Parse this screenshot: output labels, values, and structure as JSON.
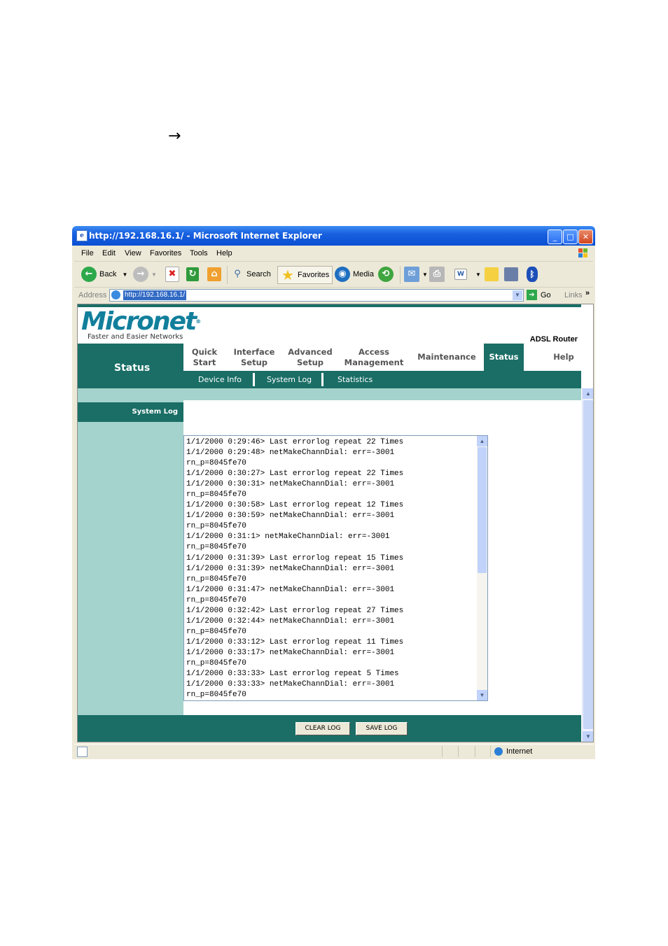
{
  "doc": {
    "arrow": "→"
  },
  "window": {
    "title": "http://192.168.16.1/ - Microsoft Internet Explorer",
    "minimize": "_",
    "maximize": "□",
    "close": "✕"
  },
  "menu": [
    "File",
    "Edit",
    "View",
    "Favorites",
    "Tools",
    "Help"
  ],
  "toolbar": {
    "back": "Back",
    "search": "Search",
    "favorites": "Favorites",
    "media": "Media"
  },
  "address": {
    "label": "Address",
    "value": "http://192.168.16.1/",
    "go": "Go",
    "links": "Links",
    "more": "»"
  },
  "router": {
    "logo": "Micronet",
    "logo_mark": "®",
    "tagline": "Faster and Easier Networks",
    "product": "ADSL Router",
    "section": "Status",
    "tabs": [
      {
        "l1": "Quick",
        "l2": "Start"
      },
      {
        "l1": "Interface",
        "l2": "Setup"
      },
      {
        "l1": "Advanced",
        "l2": "Setup"
      },
      {
        "l1": "Access",
        "l2": "Management"
      },
      {
        "l1": "Maintenance",
        "l2": ""
      },
      {
        "l1": "Status",
        "l2": ""
      },
      {
        "l1": "Help",
        "l2": ""
      }
    ],
    "subtabs": [
      "Device Info",
      "System Log",
      "Statistics"
    ],
    "page_section": "System Log",
    "log_lines": [
      "1/1/2000 0:29:46> Last errorlog repeat 22 Times",
      "1/1/2000 0:29:48> netMakeChannDial: err=-3001",
      "rn_p=8045fe70",
      "1/1/2000 0:30:27> Last errorlog repeat 22 Times",
      "1/1/2000 0:30:31> netMakeChannDial: err=-3001",
      "rn_p=8045fe70",
      "1/1/2000 0:30:58> Last errorlog repeat 12 Times",
      "1/1/2000 0:30:59> netMakeChannDial: err=-3001",
      "rn_p=8045fe70",
      "1/1/2000 0:31:1> netMakeChannDial: err=-3001",
      "rn_p=8045fe70",
      "1/1/2000 0:31:39> Last errorlog repeat 15 Times",
      "1/1/2000 0:31:39> netMakeChannDial: err=-3001",
      "rn_p=8045fe70",
      "1/1/2000 0:31:47> netMakeChannDial: err=-3001",
      "rn_p=8045fe70",
      "1/1/2000 0:32:42> Last errorlog repeat 27 Times",
      "1/1/2000 0:32:44> netMakeChannDial: err=-3001",
      "rn_p=8045fe70",
      "1/1/2000 0:33:12> Last errorlog repeat 11 Times",
      "1/1/2000 0:33:17> netMakeChannDial: err=-3001",
      "rn_p=8045fe70",
      "1/1/2000 0:33:33> Last errorlog repeat 5 Times",
      "1/1/2000 0:33:33> netMakeChannDial: err=-3001",
      "rn_p=8045fe70"
    ],
    "buttons": {
      "clear": "CLEAR LOG",
      "save": "SAVE LOG"
    }
  },
  "status": {
    "zone": "Internet"
  },
  "colors": {
    "teal_dark": "#1a6e66",
    "teal_light": "#a4d2cc",
    "logo_blue": "#117f9c",
    "xp_blue": "#0a4fd2"
  },
  "icons": [
    "back-icon",
    "forward-icon",
    "stop-icon",
    "refresh-icon",
    "home-icon",
    "search-icon",
    "favorites-star-icon",
    "media-icon",
    "history-icon",
    "mail-icon",
    "print-icon",
    "edit-icon",
    "discuss-icon",
    "messenger-icon",
    "bluetooth-icon",
    "windows-flag-icon",
    "globe-icon"
  ]
}
